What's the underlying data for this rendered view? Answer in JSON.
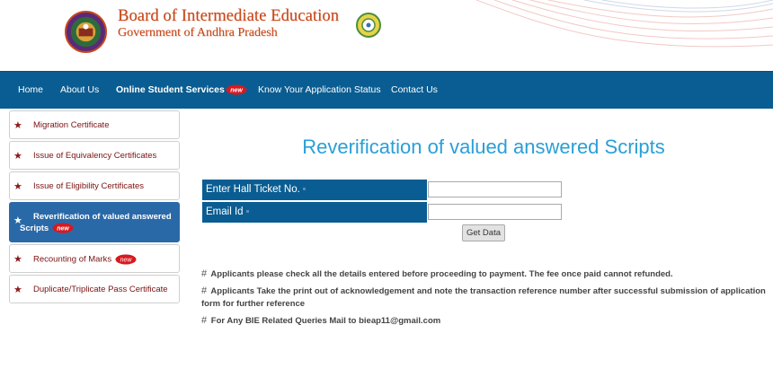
{
  "header": {
    "board_title": "Board of Intermediate Education",
    "board_subtitle": "Government of Andhra Pradesh",
    "emblem_icon": "bie-emblem-icon",
    "state_logo_icon": "andhra-pradesh-emblem-icon"
  },
  "navbar": {
    "items": [
      {
        "label": "Home"
      },
      {
        "label": "About Us"
      },
      {
        "label": "Online Student Services",
        "badge": "new"
      },
      {
        "label": "Know Your Application Status"
      },
      {
        "label": "Contact Us"
      }
    ]
  },
  "sidebar": {
    "items": [
      {
        "label": "Migration Certificate"
      },
      {
        "label": "Issue of Equivalency Certificates"
      },
      {
        "label": "Issue of Eligibility Certificates"
      },
      {
        "label": "Reverification of valued answered Scripts",
        "badge": "new",
        "active": true
      },
      {
        "label": "Recounting of Marks",
        "badge": "new"
      },
      {
        "label": "Duplicate/Triplicate Pass Certificate"
      }
    ]
  },
  "main": {
    "title": "Reverification of valued answered Scripts",
    "form": {
      "hall_ticket_label": "Enter Hall Ticket No.",
      "hall_ticket_value": "",
      "email_label": "Email Id",
      "email_value": "",
      "submit_label": "Get Data"
    },
    "notes": [
      "Applicants please check all the details entered before proceeding to payment. The fee once paid cannot refunded.",
      "Applicants Take the print out of acknowledgement and note the transaction reference number after successful submission of application form for further reference",
      "For Any BIE Related Queries Mail to bieap11@gmail.com"
    ],
    "note_bullet": "#"
  },
  "colors": {
    "nav_blue": "#0a5d92",
    "title_blue": "#2a9fd6",
    "brand_orange": "#c8471b",
    "sidebar_text": "#7a1212",
    "active_item": "#2a69a8"
  }
}
